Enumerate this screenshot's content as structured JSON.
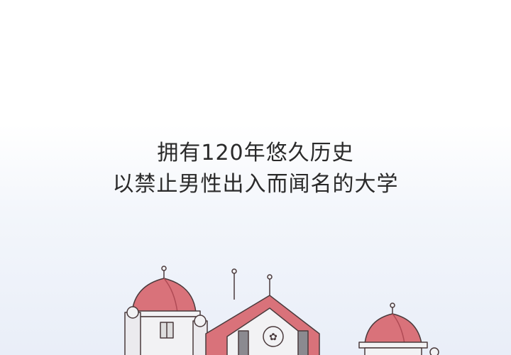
{
  "caption": {
    "line1": "拥有120年悠久历史",
    "line2": "以禁止男性出入而闻名的大学"
  },
  "illustration": {
    "subject": "university-building-icon",
    "colors": {
      "roof": "#d9727a",
      "roof_dark": "#b04b55",
      "wall": "#f2f2f4",
      "outline": "#4a3a3c",
      "shadow": "#c8c6cc",
      "sky": "#e9eef8"
    }
  }
}
